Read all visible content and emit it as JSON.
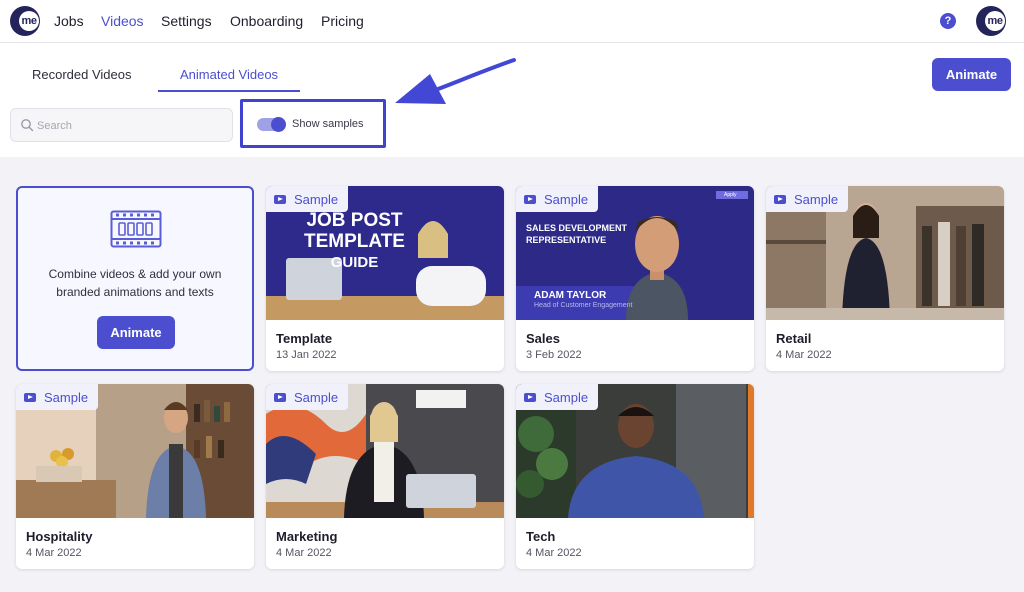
{
  "nav": {
    "logo_text": "me",
    "items": [
      {
        "label": "Jobs",
        "active": false
      },
      {
        "label": "Videos",
        "active": true
      },
      {
        "label": "Settings",
        "active": false
      },
      {
        "label": "Onboarding",
        "active": false
      },
      {
        "label": "Pricing",
        "active": false
      }
    ],
    "help_icon": "question-icon",
    "avatar_text": "me"
  },
  "tabs": [
    {
      "label": "Recorded Videos",
      "active": false
    },
    {
      "label": "Animated Videos",
      "active": true
    }
  ],
  "toolbar": {
    "animate_label": "Animate",
    "search_placeholder": "Search",
    "show_samples_label": "Show samples",
    "show_samples_on": true
  },
  "promo": {
    "icon": "film-strip-icon",
    "text": "Combine videos & add your own branded animations and texts",
    "button_label": "Animate"
  },
  "cards": [
    {
      "badge": "Sample",
      "title": "Template",
      "date": "13 Jan 2022",
      "overlay_lines": [
        "JOB POST",
        "TEMPLATE",
        "GUIDE"
      ]
    },
    {
      "badge": "Sample",
      "title": "Sales",
      "date": "3 Feb 2022",
      "overlay_lines": [
        "SALES DEVELOPMENT",
        "REPRESENTATIVE"
      ],
      "name_tag": "ADAM TAYLOR",
      "name_sub": "Head of Customer Engagement",
      "tag": "Apply"
    },
    {
      "badge": "Sample",
      "title": "Retail",
      "date": "4 Mar 2022"
    },
    {
      "badge": "Sample",
      "title": "Hospitality",
      "date": "4 Mar 2022"
    },
    {
      "badge": "Sample",
      "title": "Marketing",
      "date": "4 Mar 2022"
    },
    {
      "badge": "Sample",
      "title": "Tech",
      "date": "4 Mar 2022"
    }
  ],
  "colors": {
    "accent": "#4b4fcf",
    "brand_dark": "#24245a",
    "background": "#f3f3f7"
  }
}
